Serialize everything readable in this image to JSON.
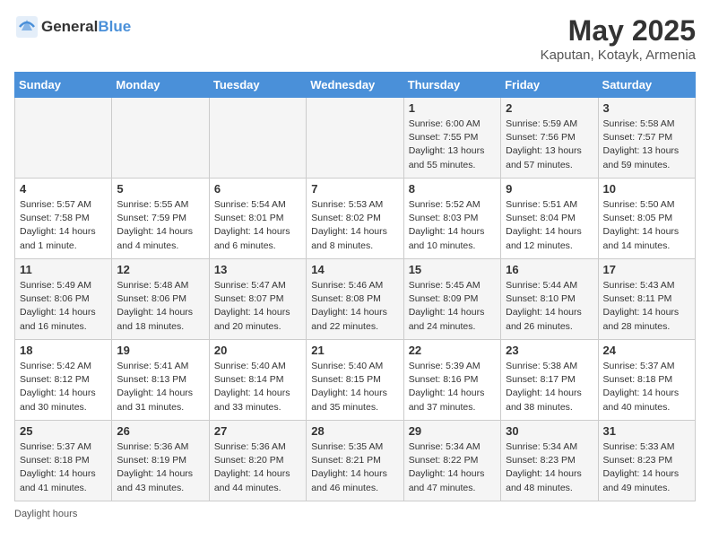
{
  "header": {
    "logo_general": "General",
    "logo_blue": "Blue",
    "title": "May 2025",
    "subtitle": "Kaputan, Kotayk, Armenia"
  },
  "calendar": {
    "days_of_week": [
      "Sunday",
      "Monday",
      "Tuesday",
      "Wednesday",
      "Thursday",
      "Friday",
      "Saturday"
    ],
    "weeks": [
      [
        {
          "day": "",
          "info": ""
        },
        {
          "day": "",
          "info": ""
        },
        {
          "day": "",
          "info": ""
        },
        {
          "day": "",
          "info": ""
        },
        {
          "day": "1",
          "info": "Sunrise: 6:00 AM\nSunset: 7:55 PM\nDaylight: 13 hours\nand 55 minutes."
        },
        {
          "day": "2",
          "info": "Sunrise: 5:59 AM\nSunset: 7:56 PM\nDaylight: 13 hours\nand 57 minutes."
        },
        {
          "day": "3",
          "info": "Sunrise: 5:58 AM\nSunset: 7:57 PM\nDaylight: 13 hours\nand 59 minutes."
        }
      ],
      [
        {
          "day": "4",
          "info": "Sunrise: 5:57 AM\nSunset: 7:58 PM\nDaylight: 14 hours\nand 1 minute."
        },
        {
          "day": "5",
          "info": "Sunrise: 5:55 AM\nSunset: 7:59 PM\nDaylight: 14 hours\nand 4 minutes."
        },
        {
          "day": "6",
          "info": "Sunrise: 5:54 AM\nSunset: 8:01 PM\nDaylight: 14 hours\nand 6 minutes."
        },
        {
          "day": "7",
          "info": "Sunrise: 5:53 AM\nSunset: 8:02 PM\nDaylight: 14 hours\nand 8 minutes."
        },
        {
          "day": "8",
          "info": "Sunrise: 5:52 AM\nSunset: 8:03 PM\nDaylight: 14 hours\nand 10 minutes."
        },
        {
          "day": "9",
          "info": "Sunrise: 5:51 AM\nSunset: 8:04 PM\nDaylight: 14 hours\nand 12 minutes."
        },
        {
          "day": "10",
          "info": "Sunrise: 5:50 AM\nSunset: 8:05 PM\nDaylight: 14 hours\nand 14 minutes."
        }
      ],
      [
        {
          "day": "11",
          "info": "Sunrise: 5:49 AM\nSunset: 8:06 PM\nDaylight: 14 hours\nand 16 minutes."
        },
        {
          "day": "12",
          "info": "Sunrise: 5:48 AM\nSunset: 8:06 PM\nDaylight: 14 hours\nand 18 minutes."
        },
        {
          "day": "13",
          "info": "Sunrise: 5:47 AM\nSunset: 8:07 PM\nDaylight: 14 hours\nand 20 minutes."
        },
        {
          "day": "14",
          "info": "Sunrise: 5:46 AM\nSunset: 8:08 PM\nDaylight: 14 hours\nand 22 minutes."
        },
        {
          "day": "15",
          "info": "Sunrise: 5:45 AM\nSunset: 8:09 PM\nDaylight: 14 hours\nand 24 minutes."
        },
        {
          "day": "16",
          "info": "Sunrise: 5:44 AM\nSunset: 8:10 PM\nDaylight: 14 hours\nand 26 minutes."
        },
        {
          "day": "17",
          "info": "Sunrise: 5:43 AM\nSunset: 8:11 PM\nDaylight: 14 hours\nand 28 minutes."
        }
      ],
      [
        {
          "day": "18",
          "info": "Sunrise: 5:42 AM\nSunset: 8:12 PM\nDaylight: 14 hours\nand 30 minutes."
        },
        {
          "day": "19",
          "info": "Sunrise: 5:41 AM\nSunset: 8:13 PM\nDaylight: 14 hours\nand 31 minutes."
        },
        {
          "day": "20",
          "info": "Sunrise: 5:40 AM\nSunset: 8:14 PM\nDaylight: 14 hours\nand 33 minutes."
        },
        {
          "day": "21",
          "info": "Sunrise: 5:40 AM\nSunset: 8:15 PM\nDaylight: 14 hours\nand 35 minutes."
        },
        {
          "day": "22",
          "info": "Sunrise: 5:39 AM\nSunset: 8:16 PM\nDaylight: 14 hours\nand 37 minutes."
        },
        {
          "day": "23",
          "info": "Sunrise: 5:38 AM\nSunset: 8:17 PM\nDaylight: 14 hours\nand 38 minutes."
        },
        {
          "day": "24",
          "info": "Sunrise: 5:37 AM\nSunset: 8:18 PM\nDaylight: 14 hours\nand 40 minutes."
        }
      ],
      [
        {
          "day": "25",
          "info": "Sunrise: 5:37 AM\nSunset: 8:18 PM\nDaylight: 14 hours\nand 41 minutes."
        },
        {
          "day": "26",
          "info": "Sunrise: 5:36 AM\nSunset: 8:19 PM\nDaylight: 14 hours\nand 43 minutes."
        },
        {
          "day": "27",
          "info": "Sunrise: 5:36 AM\nSunset: 8:20 PM\nDaylight: 14 hours\nand 44 minutes."
        },
        {
          "day": "28",
          "info": "Sunrise: 5:35 AM\nSunset: 8:21 PM\nDaylight: 14 hours\nand 46 minutes."
        },
        {
          "day": "29",
          "info": "Sunrise: 5:34 AM\nSunset: 8:22 PM\nDaylight: 14 hours\nand 47 minutes."
        },
        {
          "day": "30",
          "info": "Sunrise: 5:34 AM\nSunset: 8:23 PM\nDaylight: 14 hours\nand 48 minutes."
        },
        {
          "day": "31",
          "info": "Sunrise: 5:33 AM\nSunset: 8:23 PM\nDaylight: 14 hours\nand 49 minutes."
        }
      ]
    ]
  },
  "footer": {
    "text": "Daylight hours"
  }
}
